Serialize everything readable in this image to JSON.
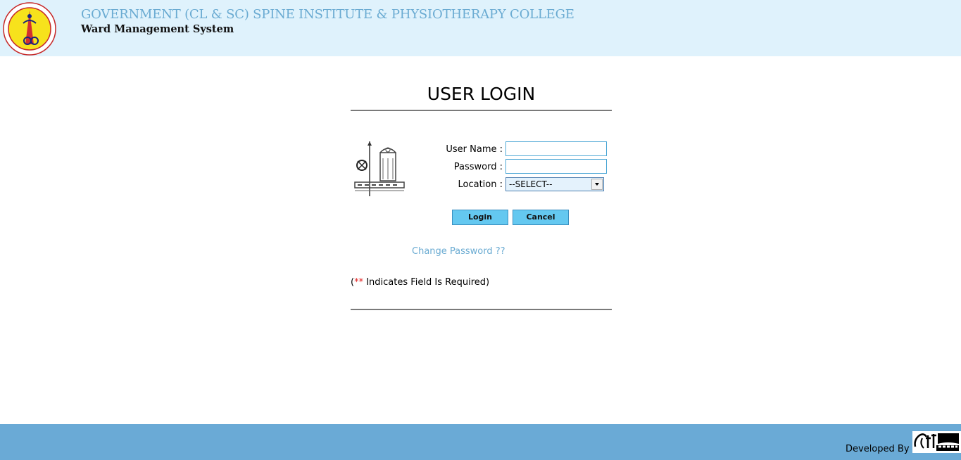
{
  "header": {
    "institute_name": "GOVERNMENT (CL & SC) SPINE INSTITUTE & PHYSIOTHERAPY COLLEGE",
    "system_name": "Ward Management System",
    "logo_icon": "institute-seal-logo"
  },
  "login": {
    "title": "USER LOGIN",
    "username_label": "User Name :",
    "username_value": "",
    "password_label": "Password :",
    "password_value": "",
    "location_label": "Location :",
    "location_selected": "--SELECT--",
    "login_button": "Login",
    "cancel_button": "Cancel",
    "change_password_link": "Change Password ??",
    "required_note": {
      "open": "(",
      "stars": "**",
      "text": " Indicates Field Is Required)"
    }
  },
  "footer": {
    "developed_by": "Developed By :",
    "dev_logo_icon": "soft-corner-logo"
  },
  "colors": {
    "header_bg": "#dff2fc",
    "institute_name": "#6aabd2",
    "footer_bg": "#6aaad6",
    "button_bg": "#64c8f0",
    "link": "#6aabd2",
    "required_star": "#e02020"
  }
}
